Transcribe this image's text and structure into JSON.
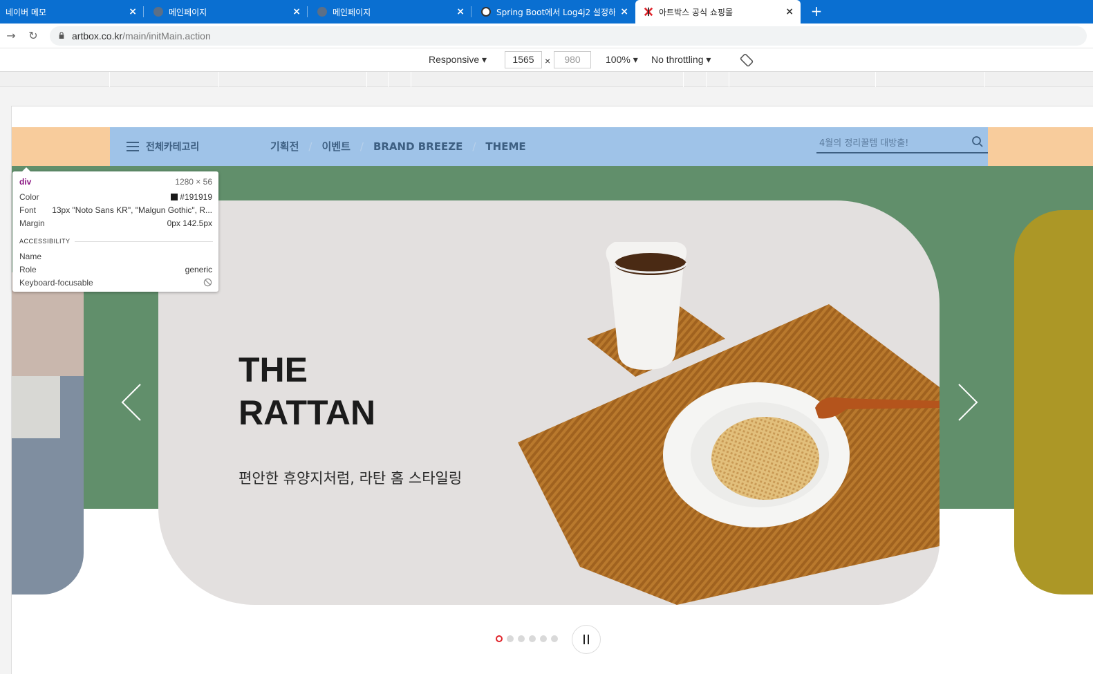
{
  "browser": {
    "tabs": [
      {
        "title": "네이버 메모",
        "favicon_color": "#0a6fd1",
        "active": false
      },
      {
        "title": "메인페이지",
        "favicon_color": "#5b6f87",
        "active": false
      },
      {
        "title": "메인페이지",
        "favicon_color": "#5b6f87",
        "active": false
      },
      {
        "title": "Spring Boot에서 Log4j2 설정하",
        "favicon_color": "#ffffff",
        "active": false
      },
      {
        "title": "아트박스 공식 쇼핑몰",
        "favicon_color": "#e0242b",
        "active": true
      }
    ],
    "new_tab_label": "+",
    "close_label": "×",
    "url_host": "artbox.co.kr",
    "url_path": "/main/initMain.action"
  },
  "device_toolbar": {
    "device": "Responsive",
    "width": "1565",
    "height": "980",
    "zoom": "100%",
    "throttling": "No throttling",
    "times": "×"
  },
  "site": {
    "category_label": "전체카테고리",
    "menu": [
      "기획전",
      "이벤트",
      "BRAND BREEZE",
      "THEME"
    ],
    "search_placeholder": "4월의 정리꿀템 대방출!",
    "colors": {
      "gnb_band": "#f8cc9c",
      "gnb": "#9fc3e8",
      "hero_bg": "#618f6b",
      "slide_bg": "#e3e0df",
      "accent_right": "#ac9726",
      "dot_active": "#e0242b"
    }
  },
  "hero": {
    "title_line1": "THE",
    "title_line2": "RATTAN",
    "subtitle": "편안한 휴양지처럼, 라탄 홈 스타일링",
    "slide_count": 6,
    "active_slide": 1
  },
  "inspector": {
    "tag": "div",
    "size": "1280 × 56",
    "color_label": "Color",
    "color_value": "#191919",
    "font_label": "Font",
    "font_value": "13px \"Noto Sans KR\", \"Malgun Gothic\", R...",
    "margin_label": "Margin",
    "margin_value": "0px 142.5px",
    "section": "ACCESSIBILITY",
    "name_label": "Name",
    "name_value": "",
    "role_label": "Role",
    "role_value": "generic",
    "kb_label": "Keyboard-focusable"
  }
}
